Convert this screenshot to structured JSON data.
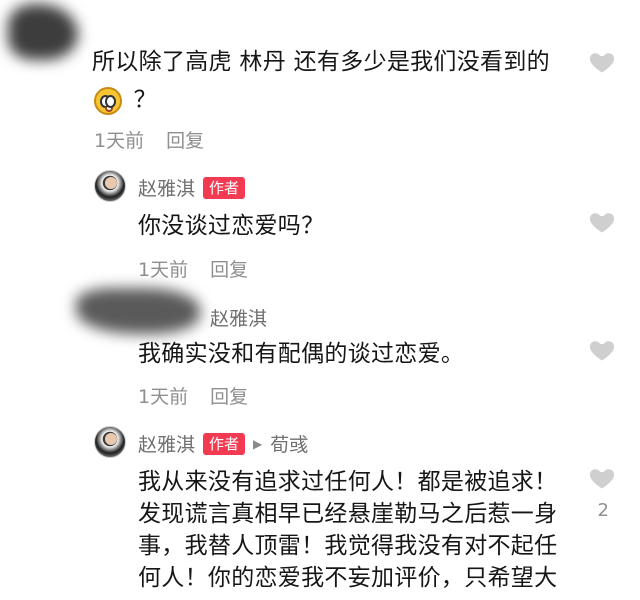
{
  "comments": [
    {
      "text_line1": "所以除了高虎 林丹 还有多少是我们没看到的",
      "text_line2": "？",
      "emoji": "smiling-face-icon",
      "time": "1天前",
      "reply_label": "回复"
    },
    {
      "author": "赵雅淇",
      "author_tag": "作者",
      "text": "你没谈过恋爱吗？",
      "time": "1天前",
      "reply_label": "回复"
    },
    {
      "author": "赵雅淇",
      "text": "我确实没和有配偶的谈过恋爱。",
      "time": "1天前",
      "reply_label": "回复"
    },
    {
      "author": "赵雅淇",
      "author_tag": "作者",
      "reply_to": "荀彧",
      "text_lines": [
        "我从来没有追求过任何人！都是被追求！",
        "发现谎言真相早已经悬崖勒马之后惹一身",
        "事，我替人顶雷！我觉得我没有对不起任",
        "何人！你的恋爱我不妄加评价，只希望大"
      ],
      "like_count": "2"
    }
  ],
  "colors": {
    "author_tag": "#f23b52",
    "meta_text": "#8f8f8f",
    "heart": "#cfcfcf"
  }
}
